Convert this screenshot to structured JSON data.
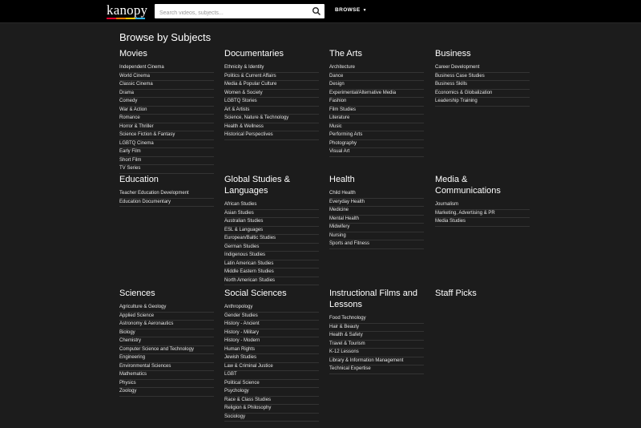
{
  "header": {
    "logo": "kanopy",
    "logo_colors": [
      "#e4002b",
      "#ff7a00",
      "#ffc600",
      "#2fb4e9"
    ],
    "search_placeholder": "Search videos, subjects...",
    "browse_label": "BROWSE"
  },
  "page_title": "Browse by Subjects",
  "categories": [
    {
      "title": "Movies",
      "items": [
        "Independent Cinema",
        "World Cinema",
        "Classic Cinema",
        "Drama",
        "Comedy",
        "War & Action",
        "Romance",
        "Horror & Thriller",
        "Science Fiction & Fantasy",
        "LGBTQ Cinema",
        "Early Film",
        "Short Film",
        "TV Series"
      ]
    },
    {
      "title": "Documentaries",
      "items": [
        "Ethnicity & Identity",
        "Politics & Current Affairs",
        "Media & Popular Culture",
        "Women & Society",
        "LGBTQ Stories",
        "Art & Artists",
        "Science, Nature & Technology",
        "Health & Wellness",
        "Historical Perspectives"
      ]
    },
    {
      "title": "The Arts",
      "items": [
        "Architecture",
        "Dance",
        "Design",
        "Experimental/Alternative Media",
        "Fashion",
        "Film Studies",
        "Literature",
        "Music",
        "Performing Arts",
        "Photography",
        "Visual Art"
      ]
    },
    {
      "title": "Business",
      "items": [
        "Career Development",
        "Business Case Studies",
        "Business Skills",
        "Economics & Globalization",
        "Leadership Training"
      ]
    },
    {
      "title": "Education",
      "items": [
        "Teacher Education Development",
        "Education Documentary"
      ]
    },
    {
      "title": "Global Studies & Languages",
      "items": [
        "African Studies",
        "Asian Studies",
        "Australian Studies",
        "ESL & Languages",
        "European/Baltic Studies",
        "German Studies",
        "Indigenous Studies",
        "Latin American Studies",
        "Middle Eastern Studies",
        "North American Studies"
      ]
    },
    {
      "title": "Health",
      "items": [
        "Child Health",
        "Everyday Health",
        "Medicine",
        "Mental Health",
        "Midwifery",
        "Nursing",
        "Sports and Fitness"
      ]
    },
    {
      "title": "Media & Communications",
      "items": [
        "Journalism",
        "Marketing, Advertising & PR",
        "Media Studies"
      ]
    },
    {
      "title": "Sciences",
      "items": [
        "Agriculture & Geology",
        "Applied Science",
        "Astronomy & Aeronautics",
        "Biology",
        "Chemistry",
        "Computer Science and Technology",
        "Engineering",
        "Environmental Sciences",
        "Mathematics",
        "Physics",
        "Zoology"
      ]
    },
    {
      "title": "Social Sciences",
      "items": [
        "Anthropology",
        "Gender Studies",
        "History - Ancient",
        "History - Military",
        "History - Modern",
        "Human Rights",
        "Jewish Studies",
        "Law & Criminal Justice",
        "LGBT",
        "Political Science",
        "Psychology",
        "Race & Class Studies",
        "Religion & Philosophy",
        "Sociology"
      ]
    },
    {
      "title": "Instructional Films and Lessons",
      "items": [
        "Food Technology",
        "Hair & Beauty",
        "Health & Safety",
        "Travel & Tourism",
        "K-12 Lessons",
        "Library & Information Management",
        "Technical Expertise"
      ]
    },
    {
      "title": "Staff Picks",
      "items": []
    }
  ]
}
